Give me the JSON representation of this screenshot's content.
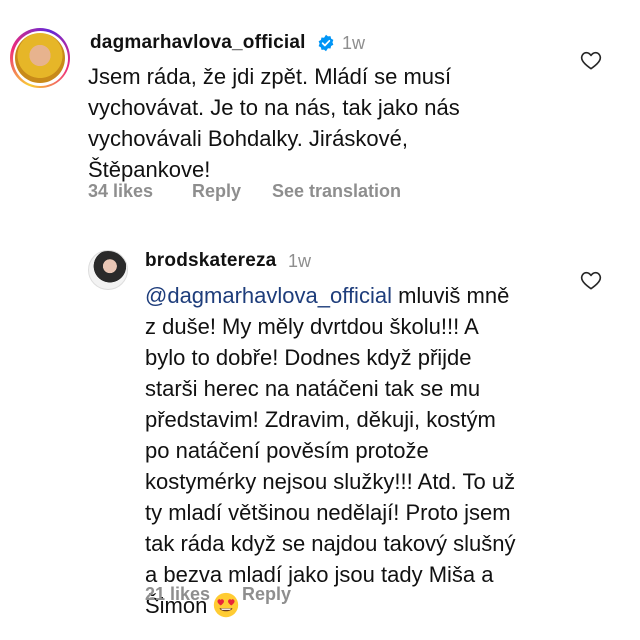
{
  "comments": [
    {
      "username": "dagmarhavlova_official",
      "verified": true,
      "time": "1w",
      "lines": [
        "Jsem ráda, že jdi zpět. Mládí se musí",
        "vychovávat. Je to na nás, tak jako nás",
        "vychovávali Bohdalky. Jiráskové,",
        "Štěpankove!"
      ],
      "likes": "34 likes",
      "reply": "Reply",
      "translate": "See translation"
    },
    {
      "username": "brodskatereza",
      "time": "1w",
      "mention": "@dagmarhavlova_official",
      "first_line_rest": " mluviš mně",
      "lines": [
        "z duše! My měly dvrtdou školu!!! A",
        "bylo to dobře! Dodnes když přijde",
        "starši herec na natáčeni tak se mu",
        "představim! Zdravim, děkuji, kostým",
        "po natáčení pověsím protože",
        "kostymérky nejsou služky!!! Atd. To už",
        "ty mladí většinou nedělají! Proto jsem",
        "tak ráda když se najdou takový slušný",
        "a bezva mladí jako jsou tady Miša a"
      ],
      "last_line": "Šimon",
      "emoji": "heart-eyes-emoji",
      "likes": "21 likes",
      "reply": "Reply"
    }
  ],
  "icons": {
    "verified": "verified-badge-icon",
    "like": "heart-outline-icon"
  },
  "colors": {
    "verified": "#0095f6",
    "muted": "#8e8e8e",
    "mention": "#1e3d7b"
  }
}
